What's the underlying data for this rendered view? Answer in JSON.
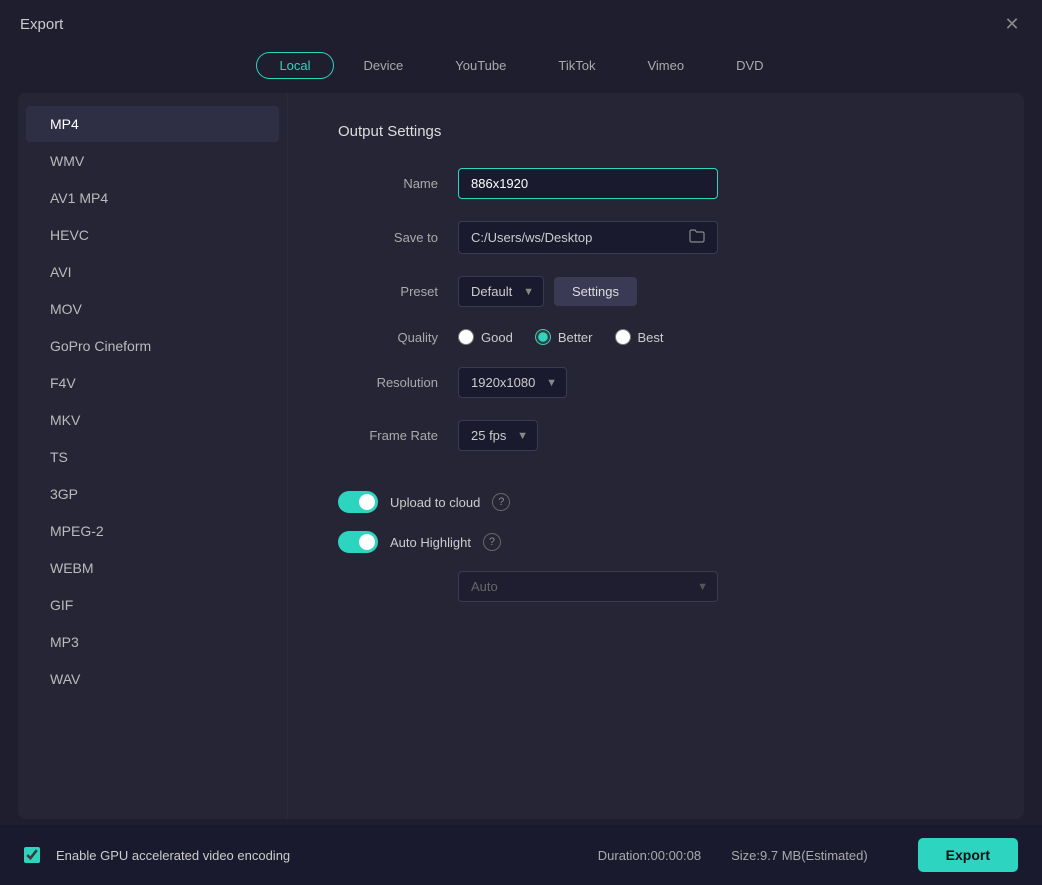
{
  "window": {
    "title": "Export"
  },
  "tabs": [
    {
      "id": "local",
      "label": "Local",
      "active": true
    },
    {
      "id": "device",
      "label": "Device",
      "active": false
    },
    {
      "id": "youtube",
      "label": "YouTube",
      "active": false
    },
    {
      "id": "tiktok",
      "label": "TikTok",
      "active": false
    },
    {
      "id": "vimeo",
      "label": "Vimeo",
      "active": false
    },
    {
      "id": "dvd",
      "label": "DVD",
      "active": false
    }
  ],
  "sidebar": {
    "items": [
      {
        "id": "mp4",
        "label": "MP4",
        "active": true
      },
      {
        "id": "wmv",
        "label": "WMV",
        "active": false
      },
      {
        "id": "av1mp4",
        "label": "AV1 MP4",
        "active": false
      },
      {
        "id": "hevc",
        "label": "HEVC",
        "active": false
      },
      {
        "id": "avi",
        "label": "AVI",
        "active": false
      },
      {
        "id": "mov",
        "label": "MOV",
        "active": false
      },
      {
        "id": "gopro",
        "label": "GoPro Cineform",
        "active": false
      },
      {
        "id": "f4v",
        "label": "F4V",
        "active": false
      },
      {
        "id": "mkv",
        "label": "MKV",
        "active": false
      },
      {
        "id": "ts",
        "label": "TS",
        "active": false
      },
      {
        "id": "3gp",
        "label": "3GP",
        "active": false
      },
      {
        "id": "mpeg2",
        "label": "MPEG-2",
        "active": false
      },
      {
        "id": "webm",
        "label": "WEBM",
        "active": false
      },
      {
        "id": "gif",
        "label": "GIF",
        "active": false
      },
      {
        "id": "mp3",
        "label": "MP3",
        "active": false
      },
      {
        "id": "wav",
        "label": "WAV",
        "active": false
      }
    ]
  },
  "outputSettings": {
    "title": "Output Settings",
    "nameLabel": "Name",
    "nameValue": "886x1920",
    "saveToLabel": "Save to",
    "saveToValue": "C:/Users/ws/Desktop",
    "presetLabel": "Preset",
    "presetValue": "Default",
    "settingsButtonLabel": "Settings",
    "qualityLabel": "Quality",
    "qualityOptions": [
      {
        "id": "good",
        "label": "Good",
        "checked": false
      },
      {
        "id": "better",
        "label": "Better",
        "checked": true
      },
      {
        "id": "best",
        "label": "Best",
        "checked": false
      }
    ],
    "resolutionLabel": "Resolution",
    "resolutionValue": "1920x1080",
    "frameRateLabel": "Frame Rate",
    "frameRateValue": "25 fps",
    "uploadToCloud": {
      "label": "Upload to cloud",
      "enabled": true
    },
    "autoHighlight": {
      "label": "Auto Highlight",
      "enabled": true
    },
    "autoSelectValue": "Auto"
  },
  "bottomBar": {
    "gpuLabel": "Enable GPU accelerated video encoding",
    "duration": "Duration:00:00:08",
    "size": "Size:9.7 MB(Estimated)",
    "exportLabel": "Export"
  }
}
